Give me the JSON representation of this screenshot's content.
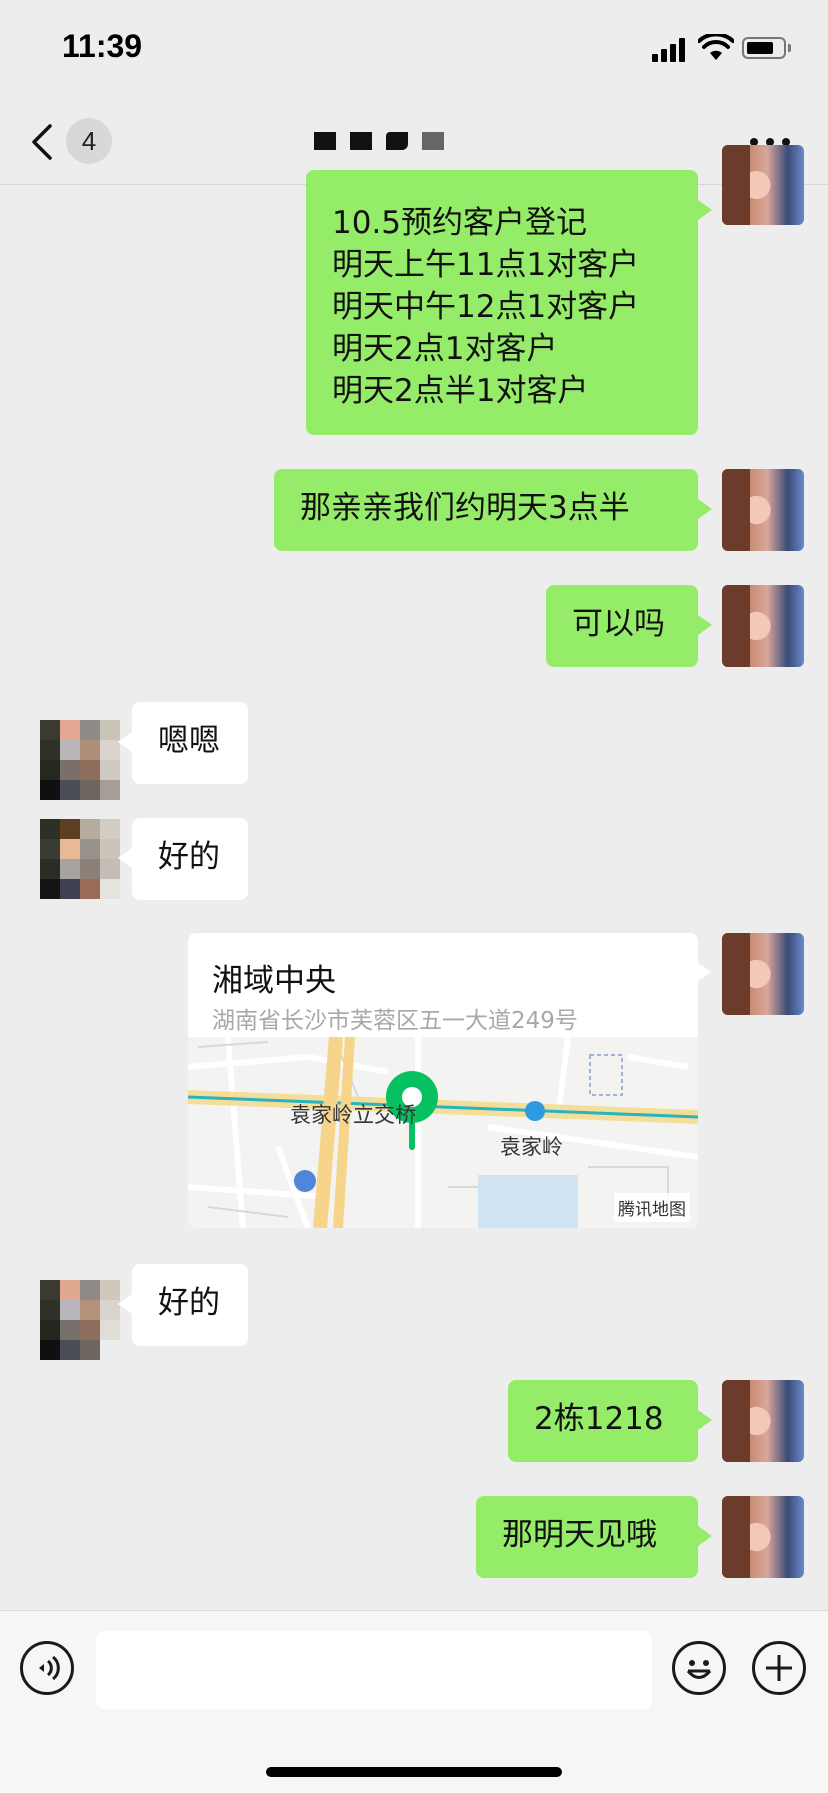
{
  "status_bar": {
    "time": "11:39",
    "battery_level": 0.75
  },
  "nav": {
    "unread_count": "4",
    "back_icon": "chevron-left-icon",
    "more_icon": "ellipsis-icon"
  },
  "messages": [
    {
      "sender": "me",
      "type": "text",
      "text": "10.5预约客户登记\n明天上午11点1对客户\n明天中午12点1对客户\n明天2点1对客户\n明天2点半1对客户"
    },
    {
      "sender": "me",
      "type": "text",
      "text": "那亲亲我们约明天3点半"
    },
    {
      "sender": "me",
      "type": "text",
      "text": "可以吗"
    },
    {
      "sender": "them",
      "type": "text",
      "text": "嗯嗯"
    },
    {
      "sender": "them",
      "type": "text",
      "text": "好的"
    },
    {
      "sender": "me",
      "type": "location",
      "name": "湘域中央",
      "address": "湖南省长沙市芙蓉区五一大道249号",
      "map": {
        "labels": [
          "袁家岭立交桥",
          "袁家岭"
        ],
        "attribution": "腾讯地图"
      }
    },
    {
      "sender": "them",
      "type": "text",
      "text": "好的"
    },
    {
      "sender": "me",
      "type": "text",
      "text": "2栋1218"
    },
    {
      "sender": "me",
      "type": "text",
      "text": "那明天见哦"
    }
  ],
  "input_bar": {
    "placeholder": "",
    "voice_icon": "voice-icon",
    "emoji_icon": "emoji-icon",
    "plus_icon": "plus-icon"
  },
  "colors": {
    "outgoing_bubble": "#95ec69",
    "incoming_bubble": "#ffffff",
    "background": "#ededed",
    "map_pin": "#07c160"
  }
}
